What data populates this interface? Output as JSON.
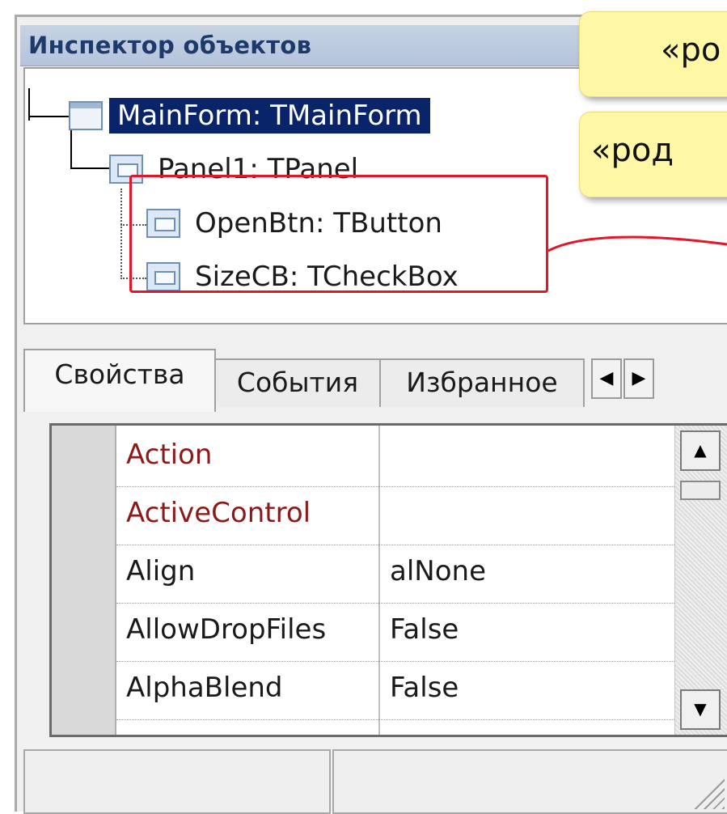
{
  "window": {
    "title": "Инспектор объектов"
  },
  "tree": {
    "items": [
      {
        "label": "MainForm: TMainForm",
        "selected": true,
        "icon": "form-icon"
      },
      {
        "label": "Panel1: TPanel",
        "selected": false,
        "icon": "panel-icon"
      },
      {
        "label": "OpenBtn: TButton",
        "selected": false,
        "icon": "button-icon"
      },
      {
        "label": "SizeCB: TCheckBox",
        "selected": false,
        "icon": "checkbox-icon"
      }
    ]
  },
  "callouts": [
    {
      "text": "«ро"
    },
    {
      "text": "«род"
    }
  ],
  "tabs": {
    "items": [
      {
        "label": "Свойства",
        "active": true
      },
      {
        "label": "События",
        "active": false
      },
      {
        "label": "Избранное",
        "active": false
      }
    ],
    "prev_icon": "triangle-left-icon",
    "next_icon": "triangle-right-icon"
  },
  "properties": {
    "rows": [
      {
        "name": "Action",
        "value": "",
        "highlight": true
      },
      {
        "name": "ActiveControl",
        "value": "",
        "highlight": true
      },
      {
        "name": "Align",
        "value": "alNone",
        "highlight": false
      },
      {
        "name": "AllowDropFiles",
        "value": "False",
        "highlight": false
      },
      {
        "name": "AlphaBlend",
        "value": "False",
        "highlight": false
      }
    ]
  },
  "colors": {
    "selection": "#0a246a",
    "highlight_name": "#8b1a1a",
    "red_outline": "#e0182a",
    "callout_bg": "#fdf7a6"
  }
}
